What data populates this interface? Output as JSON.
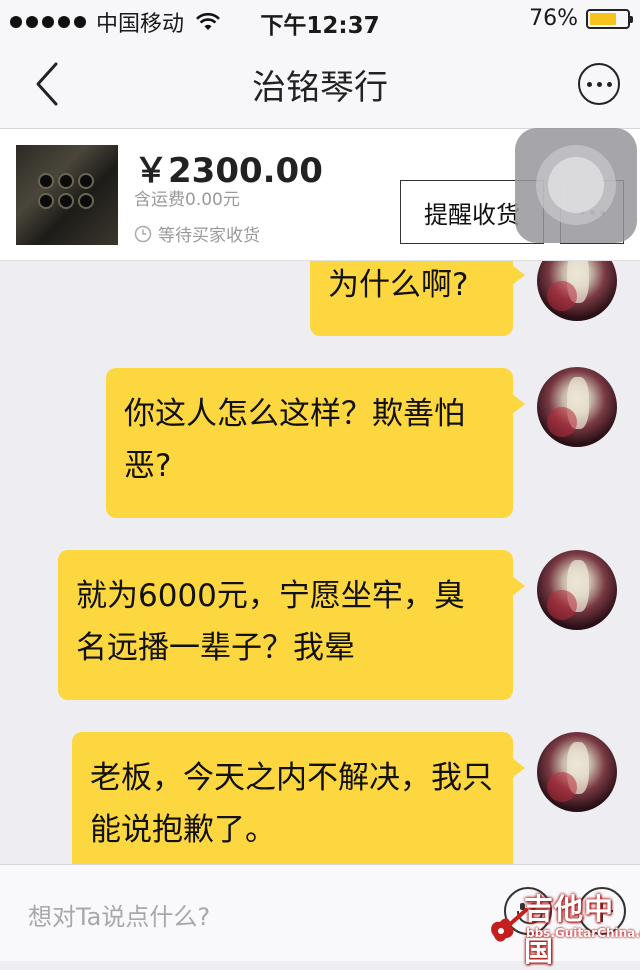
{
  "status_bar": {
    "carrier": "中国移动",
    "time": "下午12:37",
    "battery_text": "76%",
    "battery_level": 0.76,
    "signal_icon": "signal-dots-icon",
    "wifi_icon": "wifi-icon",
    "battery_icon": "battery-icon"
  },
  "nav": {
    "title": "治铭琴行",
    "back_icon": "chevron-left-icon",
    "more_icon": "more-circle-icon"
  },
  "order": {
    "price": "￥2300.00",
    "shipping": "含运费0.00元",
    "status": "等待买家收货",
    "remind_label": "提醒收货",
    "more_label": "•••",
    "status_icon": "clock-icon"
  },
  "messages": [
    {
      "text": "为什么啊?"
    },
    {
      "text": "你这人怎么这样？欺善怕恶?"
    },
    {
      "text": "就为6000元，宁愿坐牢，臭名远播一辈子？我晕"
    },
    {
      "text": "老板，今天之内不解决，我只能说抱歉了。"
    }
  ],
  "input": {
    "placeholder": "想对Ta说点什么?",
    "emoji_icon": "emoji-icon",
    "plus_icon": "plus-circle-icon"
  },
  "watermark": {
    "text": "吉他中国",
    "url": "bbs.GuitarChina.com"
  },
  "colors": {
    "bubble": "#fdd73f",
    "background": "#ededf2",
    "battery_fill": "#f6c21b"
  }
}
